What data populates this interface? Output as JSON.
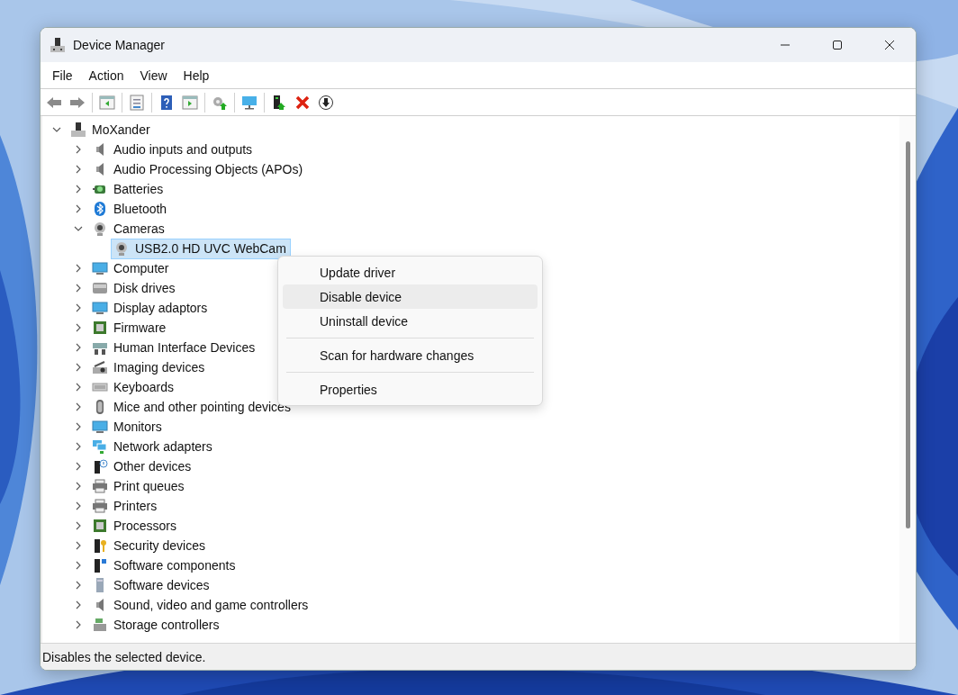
{
  "window": {
    "title": "Device Manager"
  },
  "menu": [
    "File",
    "Action",
    "View",
    "Help"
  ],
  "tree": {
    "label": "MoXander",
    "expanded": true,
    "selected": false,
    "children": [
      {
        "label": "Audio inputs and outputs",
        "expanded": false,
        "selected": false
      },
      {
        "label": "Audio Processing Objects (APOs)",
        "expanded": false,
        "selected": false
      },
      {
        "label": "Batteries",
        "expanded": false,
        "selected": false
      },
      {
        "label": "Bluetooth",
        "expanded": false,
        "selected": false
      },
      {
        "label": "Cameras",
        "expanded": true,
        "selected": false,
        "children": [
          {
            "label": "USB2.0 HD UVC WebCam",
            "selected": true
          }
        ]
      },
      {
        "label": "Computer",
        "expanded": false,
        "selected": false
      },
      {
        "label": "Disk drives",
        "expanded": false,
        "selected": false
      },
      {
        "label": "Display adaptors",
        "expanded": false,
        "selected": false
      },
      {
        "label": "Firmware",
        "expanded": false,
        "selected": false
      },
      {
        "label": "Human Interface Devices",
        "expanded": false,
        "selected": false
      },
      {
        "label": "Imaging devices",
        "expanded": false,
        "selected": false
      },
      {
        "label": "Keyboards",
        "expanded": false,
        "selected": false
      },
      {
        "label": "Mice and other pointing devices",
        "expanded": false,
        "selected": false
      },
      {
        "label": "Monitors",
        "expanded": false,
        "selected": false
      },
      {
        "label": "Network adapters",
        "expanded": false,
        "selected": false
      },
      {
        "label": "Other devices",
        "expanded": false,
        "selected": false
      },
      {
        "label": "Print queues",
        "expanded": false,
        "selected": false
      },
      {
        "label": "Printers",
        "expanded": false,
        "selected": false
      },
      {
        "label": "Processors",
        "expanded": false,
        "selected": false
      },
      {
        "label": "Security devices",
        "expanded": false,
        "selected": false
      },
      {
        "label": "Software components",
        "expanded": false,
        "selected": false
      },
      {
        "label": "Software devices",
        "expanded": false,
        "selected": false
      },
      {
        "label": "Sound, video and game controllers",
        "expanded": false,
        "selected": false
      },
      {
        "label": "Storage controllers",
        "expanded": false,
        "selected": false
      }
    ]
  },
  "context_menu": [
    {
      "kind": "item",
      "label": "Update driver",
      "selected": false
    },
    {
      "kind": "item",
      "label": "Disable device",
      "selected": true
    },
    {
      "kind": "item",
      "label": "Uninstall device",
      "selected": false
    },
    {
      "kind": "separator"
    },
    {
      "kind": "item",
      "label": "Scan for hardware changes",
      "selected": false
    },
    {
      "kind": "separator"
    },
    {
      "kind": "item",
      "label": "Properties",
      "selected": false
    }
  ],
  "status_bar": "Disables the selected device."
}
